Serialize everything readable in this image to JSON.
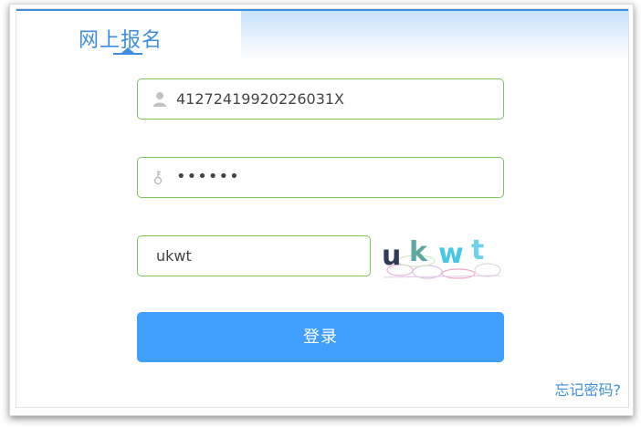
{
  "tab": {
    "label": "网上报名"
  },
  "form": {
    "id_number": "41272419920226031X",
    "password": "••••••",
    "captcha_input": "ukwt",
    "captcha_image_text": "ukwt"
  },
  "login_button": {
    "label": "登录"
  },
  "forgot_link": {
    "label": "忘记密码?"
  },
  "icons": {
    "user": "user-icon",
    "key": "key-icon"
  },
  "colors": {
    "accent": "#409efd",
    "tab_text": "#3f8ede",
    "field_border": "#7fc25e"
  }
}
